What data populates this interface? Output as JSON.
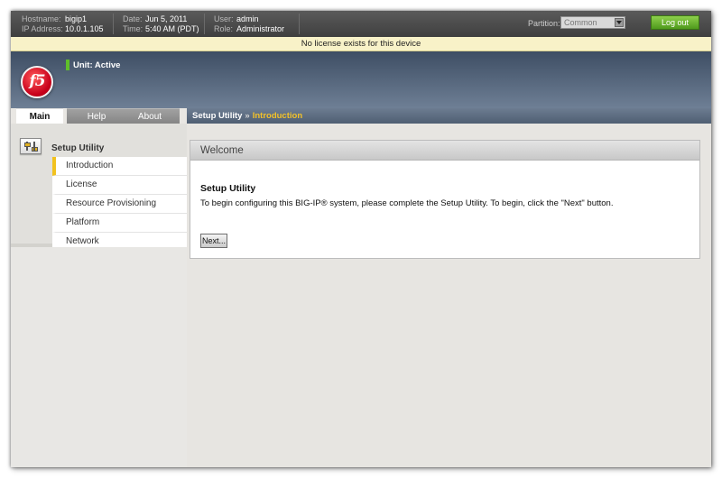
{
  "header": {
    "hostname_label": "Hostname:",
    "hostname": "bigip1",
    "ip_label": "IP Address:",
    "ip": "10.0.1.105",
    "date_label": "Date:",
    "date": "Jun 5, 2011",
    "time_label": "Time:",
    "time": "5:40 AM (PDT)",
    "user_label": "User:",
    "user": "admin",
    "role_label": "Role:",
    "role": "Administrator",
    "partition_label": "Partition:",
    "partition_value": "Common",
    "logout_label": "Log out"
  },
  "banner": {
    "license_message": "No license exists for this device"
  },
  "unit": {
    "status": "Unit: Active",
    "indicator_color": "#5fbf2a"
  },
  "logo": {
    "text": "f5"
  },
  "tabs": [
    {
      "label": "Main",
      "active": true
    },
    {
      "label": "Help",
      "active": false
    },
    {
      "label": "About",
      "active": false
    }
  ],
  "breadcrumb": {
    "parent": "Setup Utility",
    "separator": "»",
    "current": "Introduction"
  },
  "sidebar": {
    "icon": "setup-utility-icon",
    "heading": "Setup Utility",
    "items": [
      {
        "label": "Introduction",
        "selected": true
      },
      {
        "label": "License",
        "selected": false
      },
      {
        "label": "Resource Provisioning",
        "selected": false
      },
      {
        "label": "Platform",
        "selected": false
      },
      {
        "label": "Network",
        "selected": false
      }
    ]
  },
  "main": {
    "panel_title": "Welcome",
    "content_title": "Setup Utility",
    "content_text": "To begin configuring this BIG-IP® system, please complete the Setup Utility. To begin, click the \"Next\" button.",
    "next_label": "Next..."
  },
  "colors": {
    "accent_yellow": "#f2c21e",
    "breadcrumb_current": "#f3c229",
    "logout_green": "#5fae2a",
    "logo_red": "#c8001b"
  }
}
